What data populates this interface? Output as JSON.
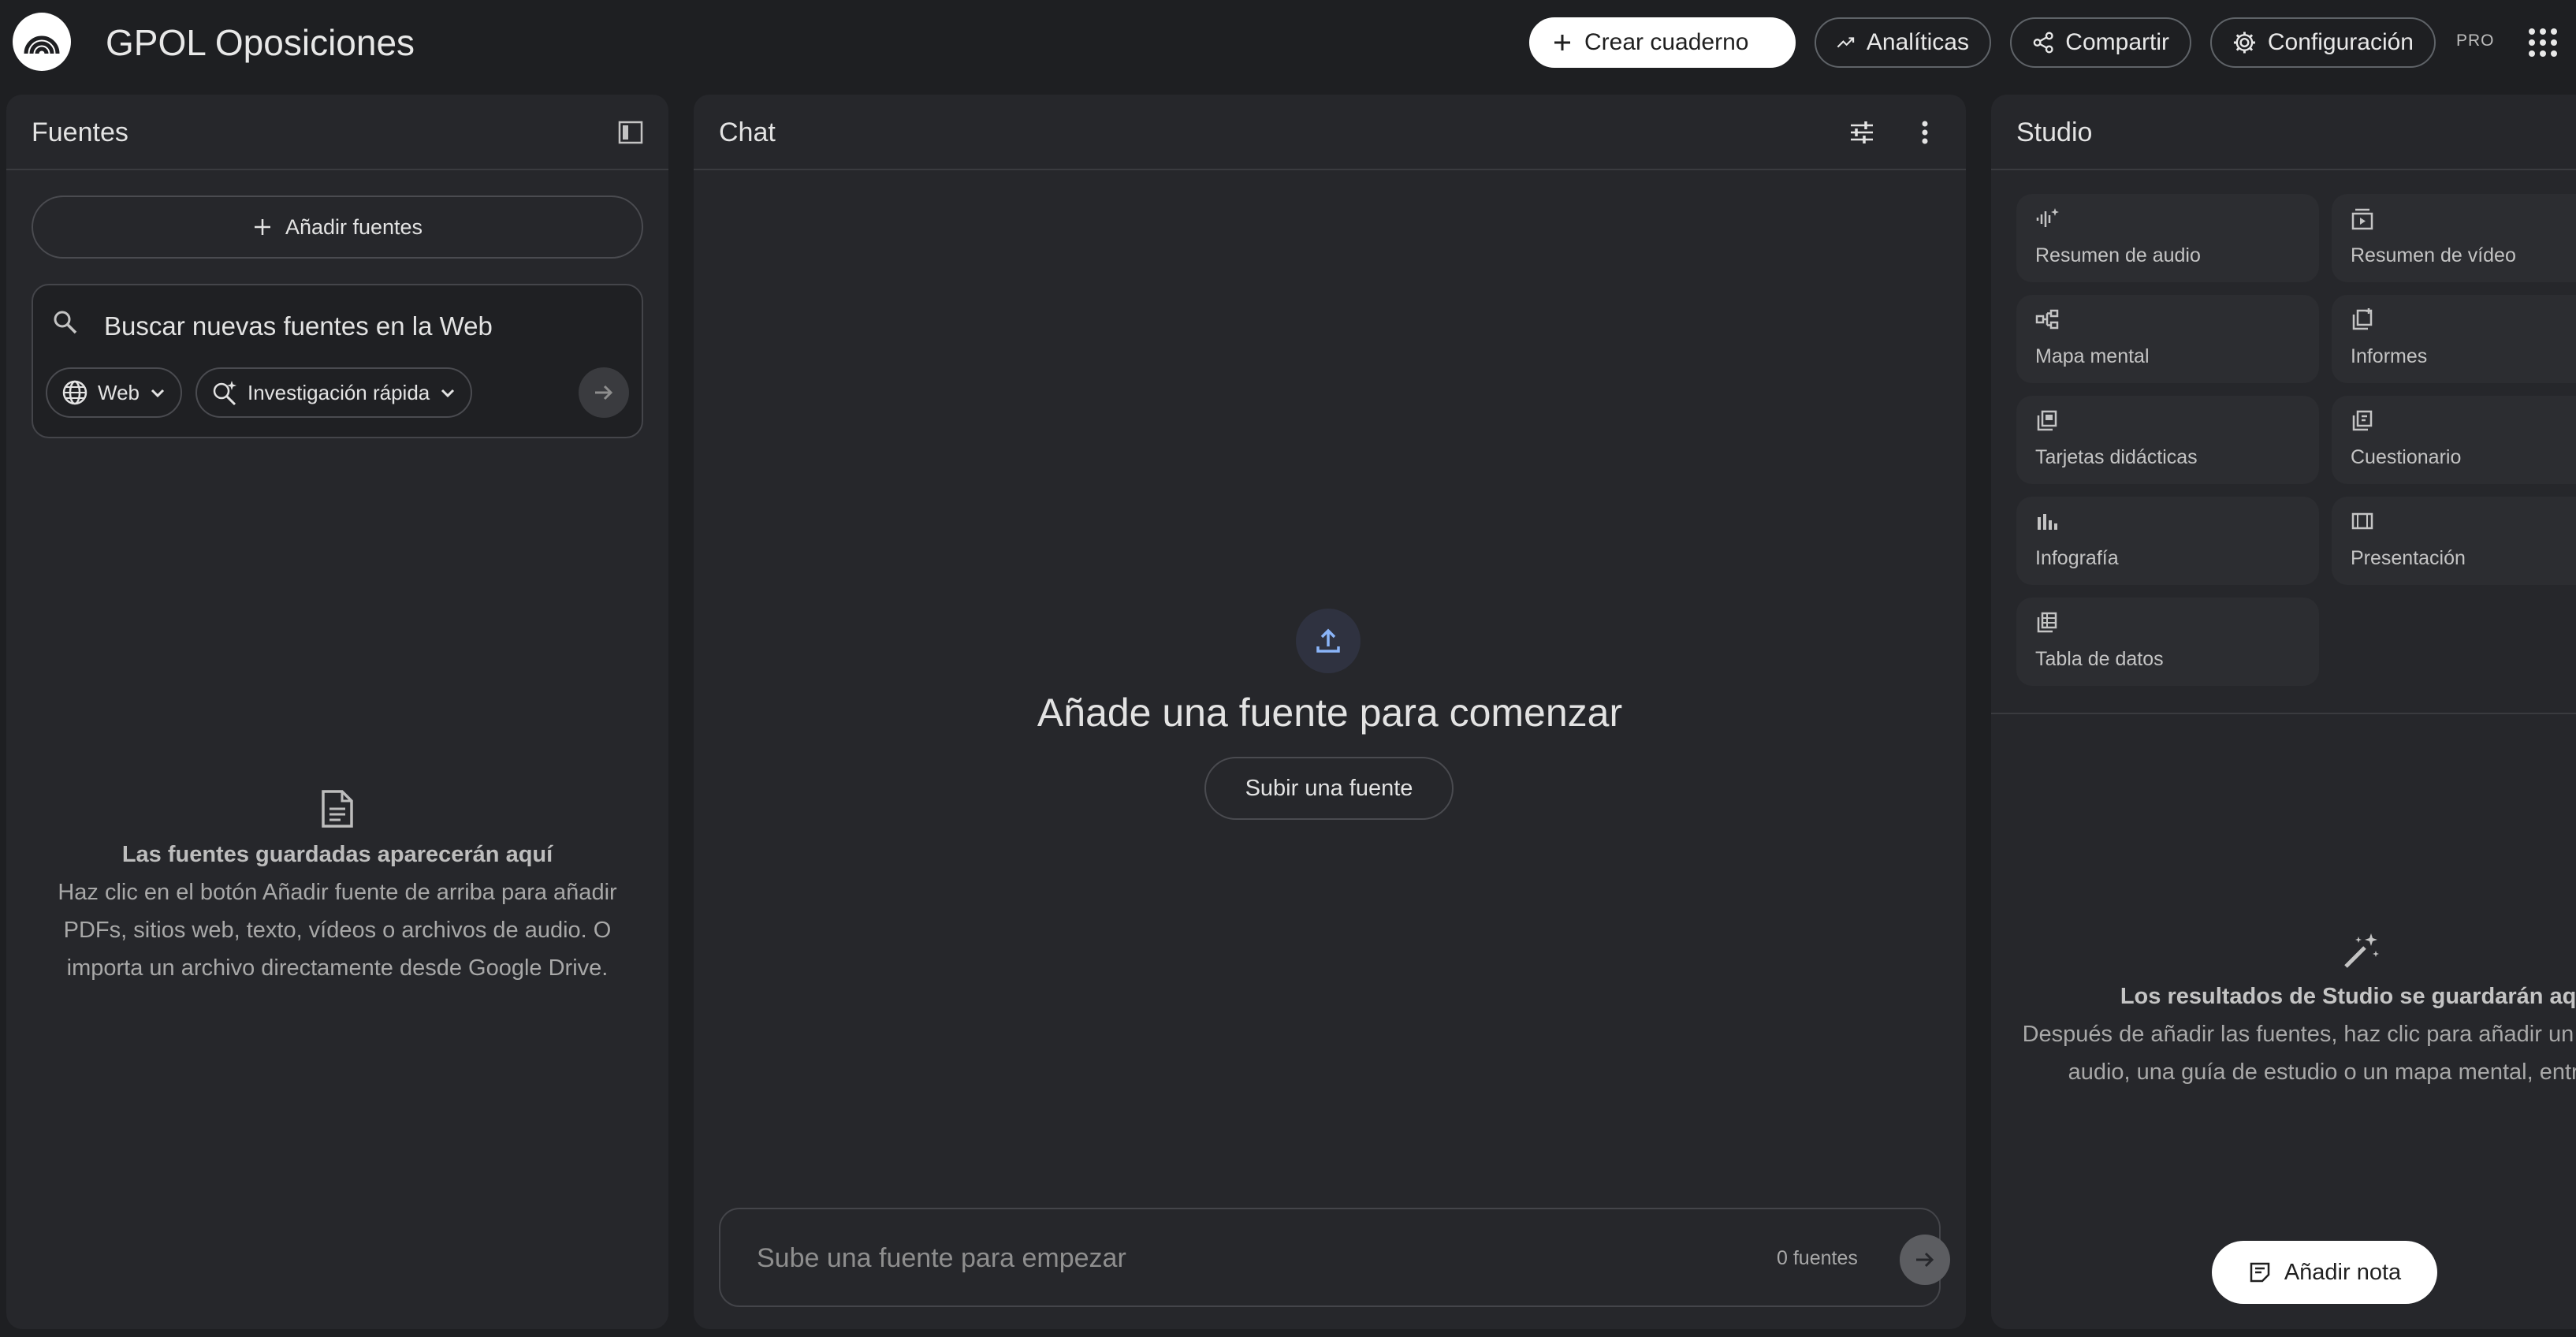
{
  "app": {
    "title": "GPOL Oposiciones"
  },
  "topbar": {
    "create_label": "Crear cuaderno",
    "analytics_label": "Analíticas",
    "share_label": "Compartir",
    "settings_label": "Configuración",
    "plan_badge": "PRO"
  },
  "sources": {
    "title": "Fuentes",
    "add_label": "Añadir fuentes",
    "search_placeholder": "Buscar nuevas fuentes en la Web",
    "chip_source": "Web",
    "chip_mode": "Investigación rápida",
    "empty_title": "Las fuentes guardadas aparecerán aquí",
    "empty_desc": "Haz clic en el botón Añadir fuente de arriba para añadir PDFs, sitios web, texto, vídeos o archivos de audio. O importa un archivo directamente desde Google Drive."
  },
  "chat": {
    "title": "Chat",
    "heading": "Añade una fuente para comenzar",
    "upload_label": "Subir una fuente",
    "input_placeholder": "Sube una fuente para empezar",
    "source_count": "0 fuentes"
  },
  "studio": {
    "title": "Studio",
    "tiles": [
      {
        "label": "Resumen de audio",
        "icon": "audio-icon"
      },
      {
        "label": "Resumen de vídeo",
        "icon": "video-icon"
      },
      {
        "label": "Mapa mental",
        "icon": "mindmap-icon"
      },
      {
        "label": "Informes",
        "icon": "report-icon"
      },
      {
        "label": "Tarjetas didácticas",
        "icon": "flashcards-icon"
      },
      {
        "label": "Cuestionario",
        "icon": "quiz-icon"
      },
      {
        "label": "Infografía",
        "icon": "infographic-icon"
      },
      {
        "label": "Presentación",
        "icon": "slides-icon"
      },
      {
        "label": "Tabla de datos",
        "icon": "table-icon"
      }
    ],
    "empty_title": "Los resultados de Studio se guardarán aquí.",
    "empty_desc": "Después de añadir las fuentes, haz clic para añadir un resumen de audio, una guía de estudio o un mapa mental, entre otros.",
    "add_note_label": "Añadir nota"
  },
  "colors": {
    "background": "#1e1f22",
    "panel": "#26272b",
    "accent": "#8ab4f8"
  }
}
